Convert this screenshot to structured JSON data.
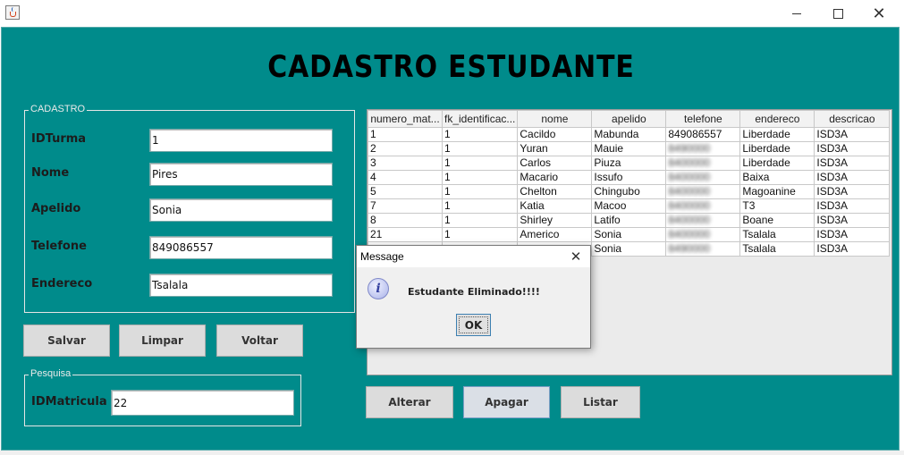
{
  "window": {
    "min_icon": "minimize-icon",
    "max_icon": "maximize-icon",
    "close_glyph": "✕"
  },
  "title": "CADASTRO ESTUDANTE",
  "cadastro": {
    "legend": "CADASTRO",
    "fields": [
      {
        "label": "IDTurma",
        "value": "1"
      },
      {
        "label": "Nome",
        "value": "Pires"
      },
      {
        "label": "Apelido",
        "value": "Sonia"
      },
      {
        "label": "Telefone",
        "value": "849086557"
      },
      {
        "label": "Endereco",
        "value": "Tsalala"
      }
    ]
  },
  "buttons": {
    "salvar": "Salvar",
    "limpar": "Limpar",
    "voltar": "Voltar",
    "alterar": "Alterar",
    "apagar": "Apagar",
    "listar": "Listar"
  },
  "pesquisa": {
    "legend": "Pesquisa",
    "label": "IDMatricula",
    "value": "22"
  },
  "table": {
    "columns": [
      "numero_mat...",
      "fk_identificac...",
      "nome",
      "apelido",
      "telefone",
      "endereco",
      "descricao"
    ],
    "rows": [
      [
        "1",
        "1",
        "Cacildo",
        "Mabunda",
        "849086557",
        "Liberdade",
        "ISD3A"
      ],
      [
        "2",
        "1",
        "Yuran",
        "Mauie",
        "",
        "Liberdade",
        "ISD3A"
      ],
      [
        "3",
        "1",
        "Carlos",
        "Piuza",
        "",
        "Liberdade",
        "ISD3A"
      ],
      [
        "4",
        "1",
        "Macario",
        "Issufo",
        "",
        "Baixa",
        "ISD3A"
      ],
      [
        "5",
        "1",
        "Chelton",
        "Chingubo",
        "",
        "Magoanine",
        "ISD3A"
      ],
      [
        "7",
        "1",
        "Katia",
        "Macoo",
        "",
        "T3",
        "ISD3A"
      ],
      [
        "8",
        "1",
        "Shirley",
        "Latifo",
        "",
        "Boane",
        "ISD3A"
      ],
      [
        "21",
        "1",
        "Americo",
        "Sonia",
        "",
        "Tsalala",
        "ISD3A"
      ],
      [
        "",
        "",
        "",
        "Sonia",
        "",
        "Tsalala",
        "ISD3A"
      ]
    ]
  },
  "dialog": {
    "title": "Message",
    "close_glyph": "✕",
    "icon_glyph": "i",
    "message": "Estudante Eliminado!!!!",
    "ok": "OK"
  }
}
